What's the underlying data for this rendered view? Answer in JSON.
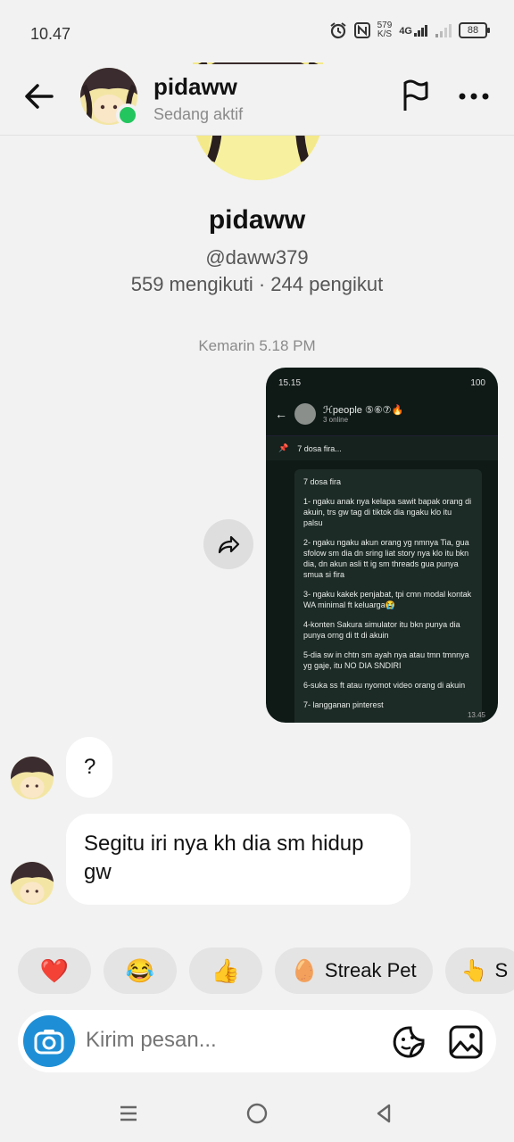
{
  "status_bar": {
    "time": "10.47",
    "speed_value": "579",
    "speed_unit": "K/S",
    "network": "4G",
    "battery": "88"
  },
  "header": {
    "name": "pidaww",
    "status": "Sedang aktif"
  },
  "profile": {
    "name": "pidaww",
    "handle": "@daww379",
    "stats": "559 mengikuti · 244 pengikut"
  },
  "timestamp": "Kemarin 5.18 PM",
  "shared_screenshot": {
    "status_time": "15.15",
    "battery": "100",
    "group_title": "ℋpeople ⑤⑥⑦🔥",
    "group_sub": "3 online",
    "pinned": "7 dosa fira...",
    "lines": [
      "7 dosa fira",
      "1- ngaku anak nya kelapa sawit bapak orang di akuin, trs gw tag di tiktok dia ngaku klo itu palsu",
      "2- ngaku ngaku akun orang yg nmnya Tia, gua sfolow sm dia dn sring liat story nya klo itu bkn dia, dn akun asli tt ig sm threads gua punya smua si fira",
      "3- ngaku kakek penjabat, tpi cmn modal kontak WA minimal ft keluarga😭",
      "4-konten Sakura simulator itu bkn punya dia punya orng di tt di akuin",
      "5-dia sw in chtn sm ayah nya atau tmn tmnnya yg gaje, itu NO DIA SNDIRI",
      "6-suka ss ft atau nyomot video orang di akuin",
      "7- langganan pinterest"
    ],
    "msg_time": "13.45"
  },
  "messages": [
    {
      "text": "?"
    },
    {
      "text": "Segitu iri nya kh dia sm hidup gw"
    }
  ],
  "quick_replies": [
    {
      "glyph": "❤️",
      "label": ""
    },
    {
      "glyph": "😂",
      "label": ""
    },
    {
      "glyph": "👍",
      "label": ""
    },
    {
      "glyph": "🥚",
      "label": "Streak Pet"
    },
    {
      "glyph": "👆",
      "label": "S"
    }
  ],
  "composer": {
    "placeholder": "Kirim pesan..."
  },
  "colors": {
    "online": "#22c55e",
    "camera": "#1e8fd6",
    "background": "#f2f2f2"
  }
}
